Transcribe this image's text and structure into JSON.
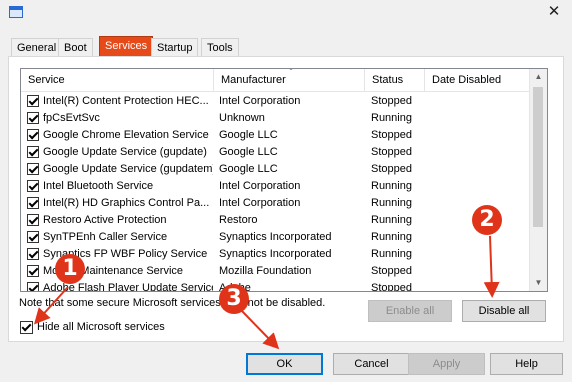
{
  "window": {
    "close_glyph": "✕"
  },
  "tabs": [
    "General",
    "Boot",
    "Services",
    "Startup",
    "Tools"
  ],
  "active_tab": "Services",
  "columns": [
    "Service",
    "Manufacturer",
    "Status",
    "Date Disabled"
  ],
  "services": [
    {
      "name": "Intel(R) Content Protection HEC...",
      "manufacturer": "Intel Corporation",
      "status": "Stopped",
      "checked": true
    },
    {
      "name": "fpCsEvtSvc",
      "manufacturer": "Unknown",
      "status": "Running",
      "checked": true
    },
    {
      "name": "Google Chrome Elevation Service",
      "manufacturer": "Google LLC",
      "status": "Stopped",
      "checked": true
    },
    {
      "name": "Google Update Service (gupdate)",
      "manufacturer": "Google LLC",
      "status": "Stopped",
      "checked": true
    },
    {
      "name": "Google Update Service (gupdatem)",
      "manufacturer": "Google LLC",
      "status": "Stopped",
      "checked": true
    },
    {
      "name": "Intel Bluetooth Service",
      "manufacturer": "Intel Corporation",
      "status": "Running",
      "checked": true
    },
    {
      "name": "Intel(R) HD Graphics Control Pa...",
      "manufacturer": "Intel Corporation",
      "status": "Running",
      "checked": true
    },
    {
      "name": "Restoro Active Protection",
      "manufacturer": "Restoro",
      "status": "Running",
      "checked": true
    },
    {
      "name": "SynTPEnh Caller Service",
      "manufacturer": "Synaptics Incorporated",
      "status": "Running",
      "checked": true
    },
    {
      "name": "Synaptics FP WBF Policy Service",
      "manufacturer": "Synaptics Incorporated",
      "status": "Running",
      "checked": true
    },
    {
      "name": "Mozilla Maintenance Service",
      "manufacturer": "Mozilla Foundation",
      "status": "Stopped",
      "checked": true
    },
    {
      "name": "Adobe Flash Player Update Service",
      "manufacturer": "Adobe",
      "status": "Stopped",
      "checked": true
    }
  ],
  "note": "Note that some secure Microsoft services may not be disabled.",
  "buttons": {
    "enable_all": "Enable all",
    "disable_all": "Disable all",
    "ok": "OK",
    "cancel": "Cancel",
    "apply": "Apply",
    "help": "Help"
  },
  "hide_ms": {
    "label": "Hide all Microsoft services",
    "checked": true
  },
  "annotations": [
    "1",
    "2",
    "3"
  ],
  "annotation_color": "#e0341a",
  "active_tab_color": "#e64a19"
}
